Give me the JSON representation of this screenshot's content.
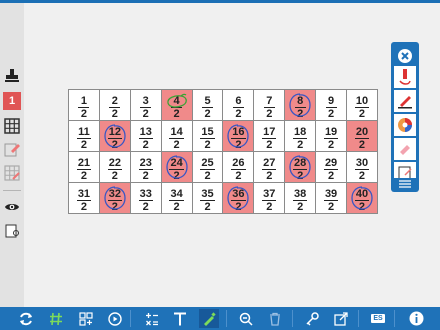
{
  "colors": {
    "toolbar_blue": "#1f72b8",
    "highlight_red": "#f08a8a",
    "ink_blue": "#3a57c4",
    "ink_green": "#3aa335"
  },
  "left_toolbar": {
    "tools": [
      {
        "name": "stamp-icon"
      },
      {
        "name": "number-badge",
        "label": "1"
      },
      {
        "name": "grid-icon"
      },
      {
        "name": "eraser-grid-icon"
      },
      {
        "name": "grid-disabled-icon"
      },
      {
        "name": "eye-icon"
      },
      {
        "name": "note-icon"
      }
    ]
  },
  "grid": {
    "denominator": "2",
    "rows": [
      [
        {
          "n": "1"
        },
        {
          "n": "2"
        },
        {
          "n": "3"
        },
        {
          "n": "4",
          "hl": true,
          "ink": "green"
        },
        {
          "n": "5"
        },
        {
          "n": "6"
        },
        {
          "n": "7"
        },
        {
          "n": "8",
          "hl": true,
          "ink": "blue"
        },
        {
          "n": "9"
        },
        {
          "n": "10"
        }
      ],
      [
        {
          "n": "11"
        },
        {
          "n": "12",
          "hl": true,
          "ink": "blue"
        },
        {
          "n": "13"
        },
        {
          "n": "14"
        },
        {
          "n": "15"
        },
        {
          "n": "16",
          "hl": true,
          "ink": "blue"
        },
        {
          "n": "17"
        },
        {
          "n": "18"
        },
        {
          "n": "19"
        },
        {
          "n": "20",
          "hl": true
        }
      ],
      [
        {
          "n": "21"
        },
        {
          "n": "22"
        },
        {
          "n": "23"
        },
        {
          "n": "24",
          "hl": true,
          "ink": "blue"
        },
        {
          "n": "25"
        },
        {
          "n": "26"
        },
        {
          "n": "27"
        },
        {
          "n": "28",
          "hl": true,
          "ink": "blue"
        },
        {
          "n": "29"
        },
        {
          "n": "30"
        }
      ],
      [
        {
          "n": "31"
        },
        {
          "n": "32",
          "hl": true,
          "ink": "blue"
        },
        {
          "n": "33"
        },
        {
          "n": "34"
        },
        {
          "n": "35"
        },
        {
          "n": "36",
          "hl": true,
          "ink": "blue"
        },
        {
          "n": "37"
        },
        {
          "n": "38"
        },
        {
          "n": "39"
        },
        {
          "n": "40",
          "hl": true,
          "ink": "blue"
        }
      ]
    ]
  },
  "palette": {
    "tools": [
      "close-icon",
      "pen-red-icon",
      "pen-highlighter-icon",
      "color-wheel-icon",
      "eraser-icon",
      "note-icon",
      "menu-icon"
    ]
  },
  "bottom_toolbar": {
    "tools": [
      "refresh-icon",
      "hash-icon",
      "grid-add-icon",
      "play-icon",
      "operations-icon",
      "text-icon",
      "pen-icon",
      "zoom-out-icon",
      "trash-icon",
      "key-icon",
      "export-icon",
      "keyboard-icon",
      "info-icon"
    ],
    "keyboard_label": "ES"
  }
}
